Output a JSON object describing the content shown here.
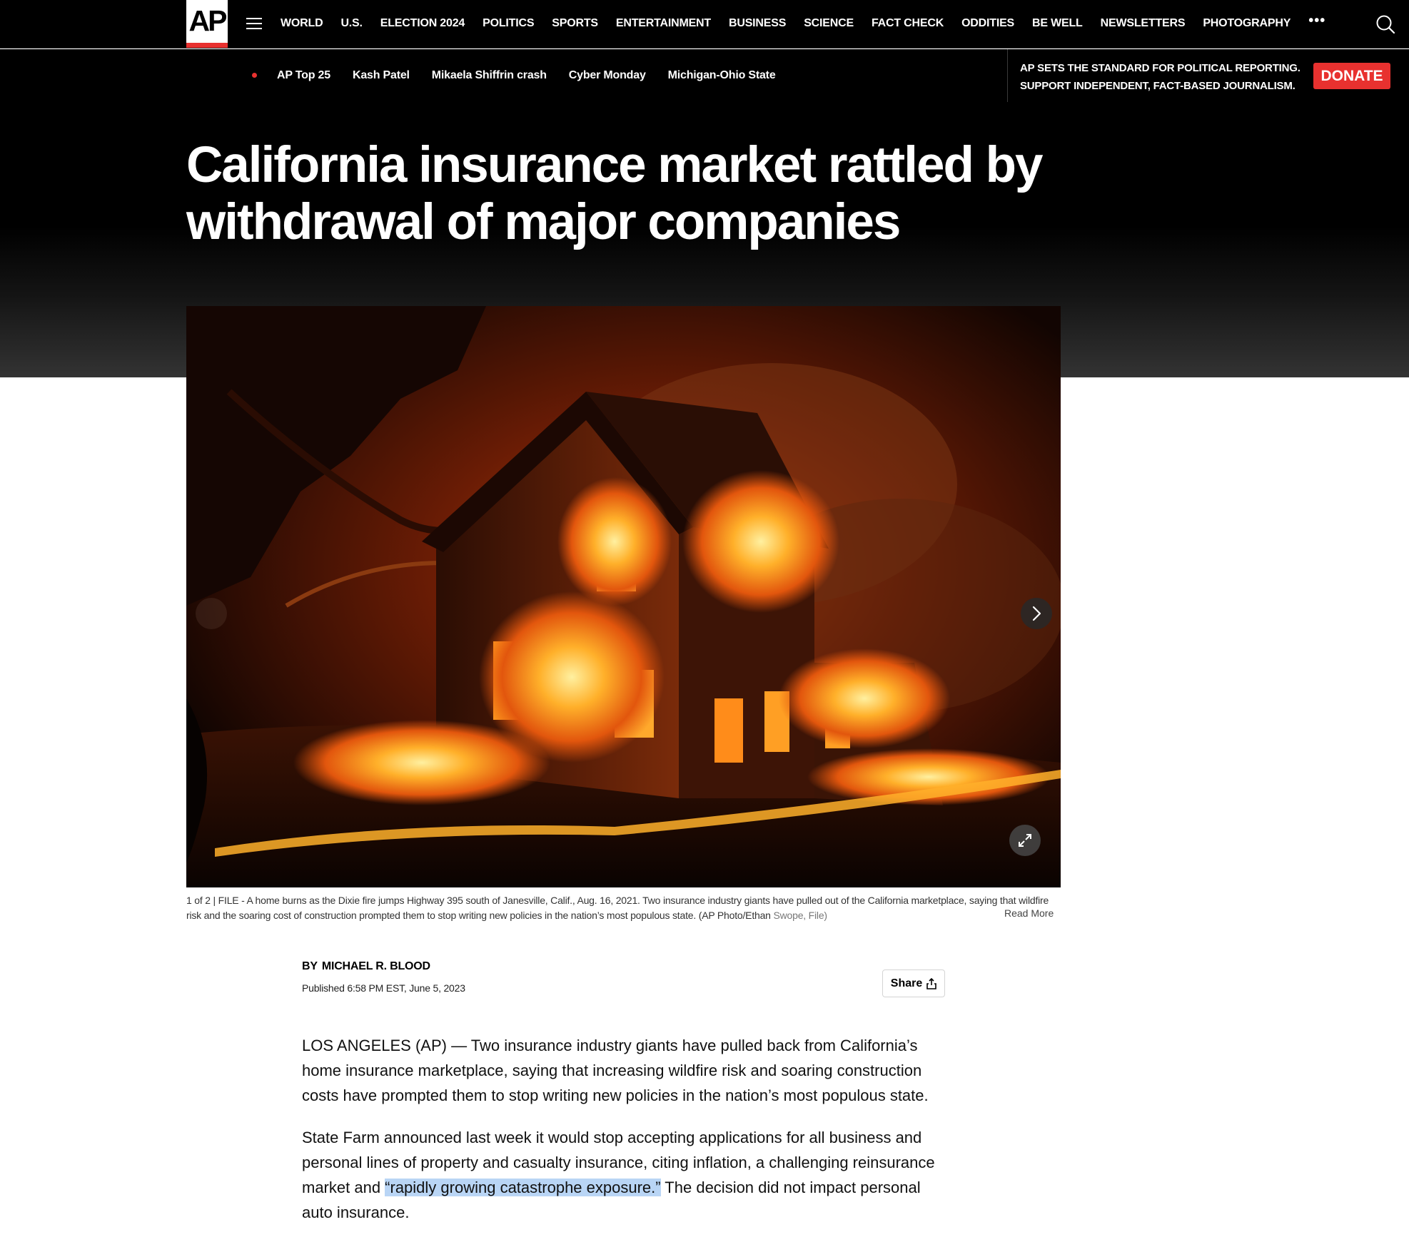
{
  "site": {
    "logo_text": "AP"
  },
  "nav": {
    "items": [
      "WORLD",
      "U.S.",
      "ELECTION 2024",
      "POLITICS",
      "SPORTS",
      "ENTERTAINMENT",
      "BUSINESS",
      "SCIENCE",
      "FACT CHECK",
      "ODDITIES",
      "BE WELL",
      "NEWSLETTERS",
      "PHOTOGRAPHY"
    ],
    "more": "•••"
  },
  "trending": {
    "items": [
      "AP Top 25",
      "Kash Patel",
      "Mikaela Shiffrin crash",
      "Cyber Monday",
      "Michigan-Ohio State"
    ]
  },
  "promo": {
    "line1": "AP SETS THE STANDARD FOR POLITICAL REPORTING.",
    "line2": "SUPPORT INDEPENDENT, FACT-BASED JOURNALISM.",
    "donate_label": "DONATE"
  },
  "colors": {
    "brand_red": "#e8312f",
    "highlight": "#b9d5f5"
  },
  "article": {
    "headline": "California insurance market rattled by withdrawal of major companies",
    "caption": {
      "counter": "1 of 2 |",
      "text": " FILE - A home burns as the Dixie fire jumps Highway 395 south of Janesville, Calif., Aug. 16, 2021. Two insurance industry giants have pulled out of the California marketplace, saying that wildfire risk and the soaring cost of construction prompted them to stop writing new policies in the nation’s most populous state. (AP Photo/Ethan",
      "text_tail": " Swope, File)",
      "read_more": "Read More"
    },
    "byline_prefix": "BY",
    "author": "MICHAEL R. BLOOD",
    "published": "Published 6:58 PM EST, June 5, 2023",
    "share_label": "Share",
    "paragraphs": {
      "p1": "LOS ANGELES (AP) — Two insurance industry giants have pulled back from California’s home insurance marketplace, saying that increasing wildfire risk and soaring construction costs have prompted them to stop writing new policies in the nation’s most populous state.",
      "p2_before": "State Farm announced last week it would stop accepting applications for all business and personal lines of property and casualty insurance, citing inflation, a challenging reinsurance market and ",
      "p2_highlight": "“rapidly growing catastrophe exposure.”",
      "p2_after": " The decision did not impact personal auto insurance."
    }
  },
  "icons": {
    "menu": "hamburger-menu-icon",
    "search": "search-icon",
    "next": "chevron-right-icon",
    "expand": "expand-icon",
    "share": "share-icon"
  }
}
